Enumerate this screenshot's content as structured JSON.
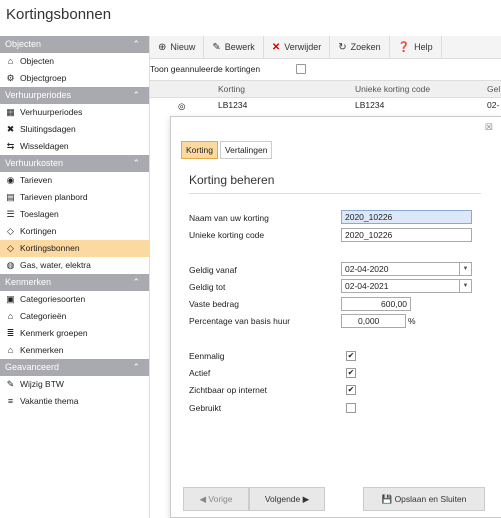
{
  "page": {
    "title": "Kortingsbonnen"
  },
  "sidebar": {
    "sections": [
      {
        "label": "Objecten",
        "items": [
          {
            "label": "Objecten",
            "icon": "house-icon"
          },
          {
            "label": "Objectgroep",
            "icon": "group-icon"
          }
        ]
      },
      {
        "label": "Verhuurperiodes",
        "items": [
          {
            "label": "Verhuurperiodes",
            "icon": "calendar-icon"
          },
          {
            "label": "Sluitingsdagen",
            "icon": "calendar-x-icon"
          },
          {
            "label": "Wisseldagen",
            "icon": "swap-icon"
          }
        ]
      },
      {
        "label": "Verhuurkosten",
        "items": [
          {
            "label": "Tarieven",
            "icon": "coins-icon"
          },
          {
            "label": "Tarieven planbord",
            "icon": "grid-icon"
          },
          {
            "label": "Toeslagen",
            "icon": "bars-icon"
          },
          {
            "label": "Kortingen",
            "icon": "tag-icon"
          },
          {
            "label": "Kortingsbonnen",
            "icon": "tag-icon",
            "active": true
          },
          {
            "label": "Gas, water, elektra",
            "icon": "meter-icon"
          }
        ]
      },
      {
        "label": "Kenmerken",
        "items": [
          {
            "label": "Categoriesoorten",
            "icon": "categories-icon"
          },
          {
            "label": "Categorieën",
            "icon": "category-house-icon"
          },
          {
            "label": "Kenmerk groepen",
            "icon": "list-icon"
          },
          {
            "label": "Kenmerken",
            "icon": "house-icon"
          }
        ]
      },
      {
        "label": "Geavanceerd",
        "items": [
          {
            "label": "Wijzig BTW",
            "icon": "tax-icon"
          },
          {
            "label": "Vakantie thema",
            "icon": "lines-icon"
          }
        ]
      }
    ]
  },
  "toolbar": {
    "new": "Nieuw",
    "edit": "Bewerk",
    "delete": "Verwijder",
    "search": "Zoeken",
    "help": "Help"
  },
  "filter": {
    "label": "Toon geannuleerde kortingen"
  },
  "grid": {
    "headers": [
      "Korting",
      "Unieke korting code",
      "Gel"
    ],
    "row": [
      "LB1234",
      "LB1234",
      "02-"
    ]
  },
  "modal": {
    "close": "☒",
    "tabs": [
      "Korting",
      "Vertalingen"
    ],
    "title": "Korting beheren",
    "fields": {
      "name_label": "Naam van uw korting",
      "name_value": "2020_10226",
      "code_label": "Unieke korting code",
      "code_value": "2020_10226",
      "from_label": "Geldig vanaf",
      "from_value": "02-04-2020",
      "to_label": "Geldig tot",
      "to_value": "02-04-2021",
      "fixed_label": "Vaste bedrag",
      "fixed_value": "600,00",
      "pct_label": "Percentage van basis huur",
      "pct_value": "0,000",
      "pct_unit": "%"
    },
    "checks": [
      {
        "label": "Eenmalig",
        "checked": true
      },
      {
        "label": "Actief",
        "checked": true
      },
      {
        "label": "Zichtbaar op internet",
        "checked": true
      },
      {
        "label": "Gebruikt",
        "checked": false
      }
    ],
    "buttons": {
      "prev": "Vorige",
      "next": "Volgende",
      "save": "Opslaan en Sluiten"
    }
  }
}
